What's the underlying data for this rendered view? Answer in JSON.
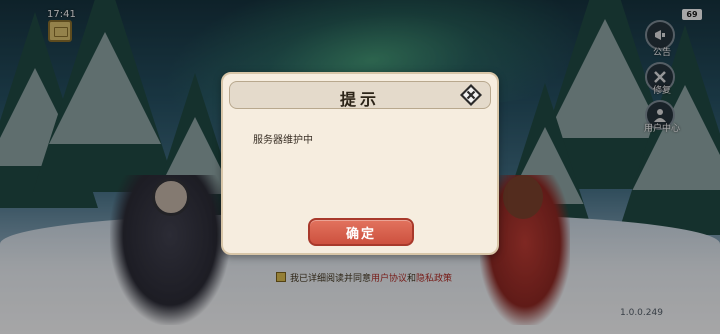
{
  "status_bar": {
    "time": "17:41",
    "battery": "69"
  },
  "side_menu": [
    {
      "label": "公告",
      "icon": "notice-icon"
    },
    {
      "label": "修复",
      "icon": "repair-icon"
    },
    {
      "label": "用户中心",
      "icon": "user-center-icon"
    }
  ],
  "footer": {
    "agree_prefix": "我已详细阅读并同意",
    "agree_link_1": "用户协议",
    "agree_and": "和",
    "agree_link_2": "隐私政策",
    "version": "1.0.0.249"
  },
  "dialog": {
    "title": "提示",
    "message": "服务器维护中",
    "confirm_label": "确定",
    "close_icon": "close-diamond-icon"
  },
  "colors": {
    "dialog_bg": "#f6eddf",
    "confirm_button": "#cd513f",
    "header_bg": "#e4dacb"
  }
}
